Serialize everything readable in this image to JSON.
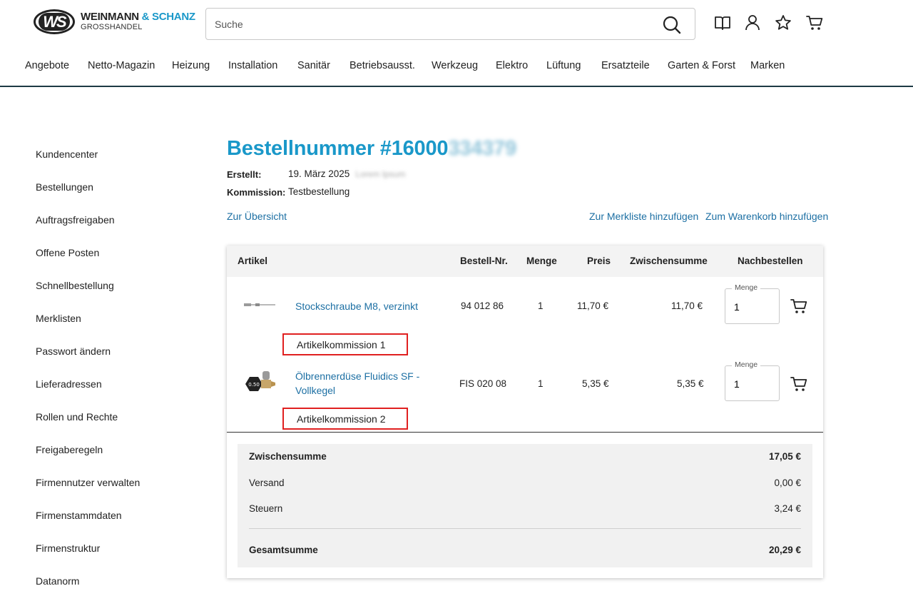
{
  "brand": {
    "badge": "WS",
    "name_part1": "WEINMANN",
    "name_part2": "& SCHANZ",
    "subtitle": "GROSSHANDEL"
  },
  "search": {
    "placeholder": "Suche",
    "value": ""
  },
  "header_icons": [
    "catalog-book-icon",
    "user-icon",
    "star-icon",
    "cart-icon"
  ],
  "nav": [
    "Angebote",
    "Netto-Magazin",
    "Heizung",
    "Installation",
    "Sanitär",
    "Betriebsausst.",
    "Werkzeug",
    "Elektro",
    "Lüftung",
    "Ersatzteile",
    "Garten & Forst",
    "Marken"
  ],
  "sidebar": [
    "Kundencenter",
    "Bestellungen",
    "Auftragsfreigaben",
    "Offene Posten",
    "Schnellbestellung",
    "Merklisten",
    "Passwort ändern",
    "Lieferadressen",
    "Rollen und Rechte",
    "Freigaberegeln",
    "Firmennutzer verwalten",
    "Firmenstammdaten",
    "Firmenstruktur",
    "Datanorm"
  ],
  "order": {
    "title_prefix": "Bestellnummer #16000",
    "title_redacted": "334379",
    "created_label": "Erstellt:",
    "created_value": "19. März 2025",
    "created_redacted": "Lorem Ipsum",
    "commission_label": "Kommission:",
    "commission_value": "Testbestellung"
  },
  "actions": {
    "back": "Zur Übersicht",
    "wishlist": "Zur Merkliste hinzufügen",
    "cart": "Zum Warenkorb hinzufügen"
  },
  "table": {
    "headers": {
      "article": "Artikel",
      "order_no": "Bestell-Nr.",
      "qty": "Menge",
      "price": "Preis",
      "subtotal": "Zwischensumme",
      "reorder": "Nachbestellen"
    },
    "qty_field_label": "Menge",
    "rows": [
      {
        "name": "Stockschraube M8, verzinkt",
        "order_no": "94 012 86",
        "qty": "1",
        "price": "11,70 €",
        "subtotal": "11,70 €",
        "reorder_qty": "1",
        "commission": "Artikelkommission 1",
        "thumb": "screw-image"
      },
      {
        "name": "Ölbrennerdüse Fluidics SF - Vollkegel",
        "order_no": "FIS 020 08",
        "qty": "1",
        "price": "5,35 €",
        "subtotal": "5,35 €",
        "reorder_qty": "1",
        "commission": "Artikelkommission 2",
        "thumb": "nozzle-image"
      }
    ]
  },
  "totals": {
    "subtotal_label": "Zwischensumme",
    "subtotal_value": "17,05 €",
    "shipping_label": "Versand",
    "shipping_value": "0,00 €",
    "tax_label": "Steuern",
    "tax_value": "3,24 €",
    "total_label": "Gesamtsumme",
    "total_value": "20,29 €"
  },
  "colors": {
    "accent": "#1a98c9",
    "link": "#1c6fa3",
    "highlight_box": "#e02020",
    "header_rule": "#1d3a44"
  }
}
